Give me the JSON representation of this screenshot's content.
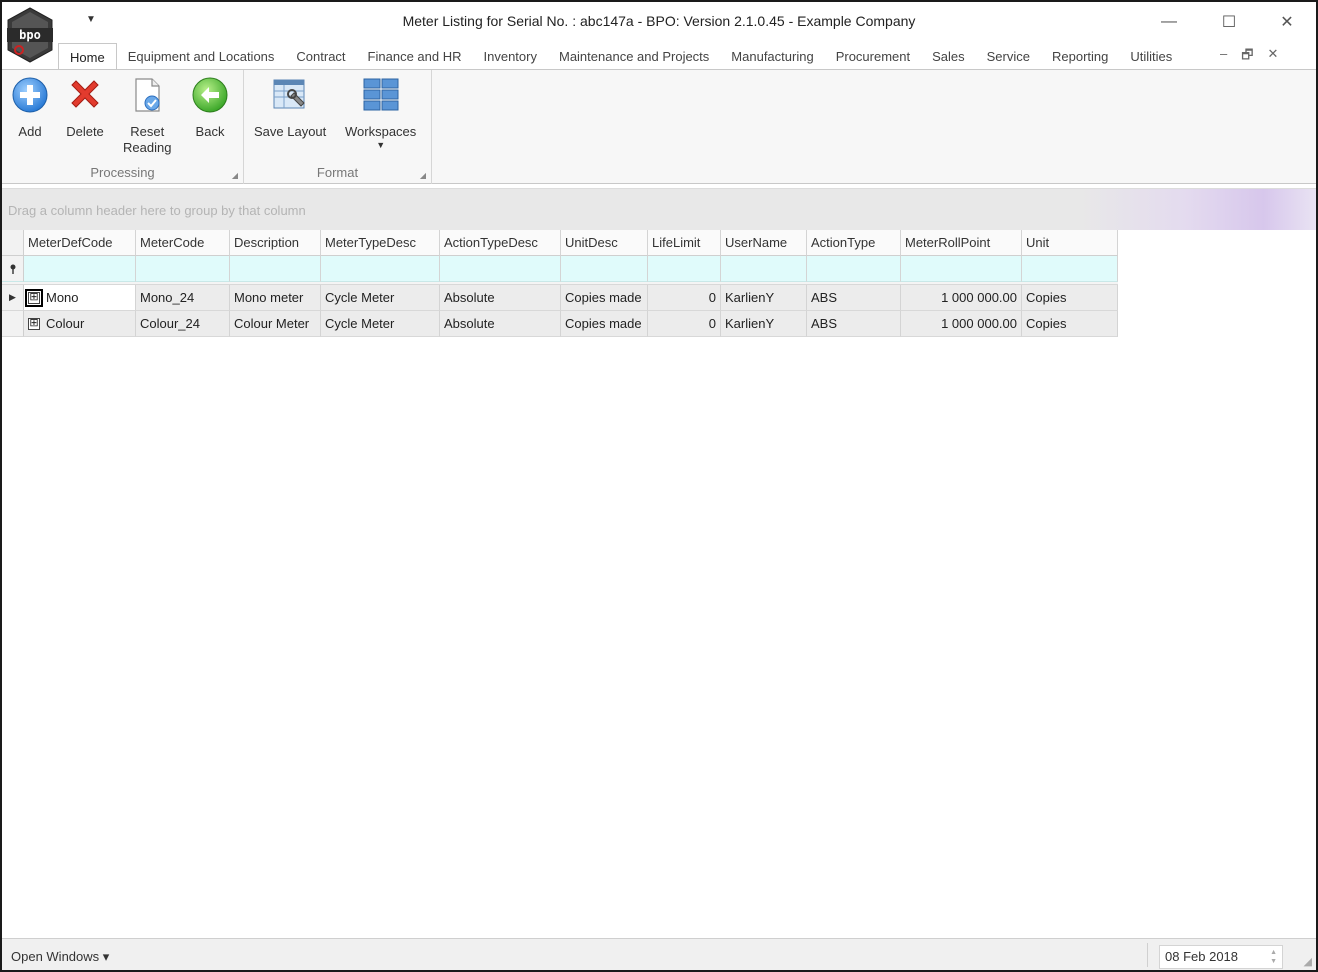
{
  "window": {
    "title": "Meter Listing for Serial No. : abc147a - BPO: Version 2.1.0.45 - Example Company",
    "logo_text": "bpo",
    "qat_icon": "dropdown-arrow-icon",
    "minimize_glyph": "—",
    "maximize_glyph": "☐",
    "close_glyph": "✕"
  },
  "menu": {
    "tabs": [
      "Home",
      "Equipment and Locations",
      "Contract",
      "Finance and HR",
      "Inventory",
      "Maintenance and Projects",
      "Manufacturing",
      "Procurement",
      "Sales",
      "Service",
      "Reporting",
      "Utilities"
    ],
    "active_tab": "Home",
    "mdi_minimize": "–",
    "mdi_restore": "🗗",
    "mdi_close": "✕"
  },
  "ribbon": {
    "groups": [
      {
        "label": "Processing",
        "buttons": [
          {
            "label": "Add",
            "icon": "add-plus-icon"
          },
          {
            "label": "Delete",
            "icon": "delete-x-icon"
          },
          {
            "label_line1": "Reset",
            "label_line2": "Reading",
            "icon": "reset-reading-document-icon"
          },
          {
            "label": "Back",
            "icon": "back-arrow-icon"
          }
        ]
      },
      {
        "label": "Format",
        "buttons": [
          {
            "label": "Save Layout",
            "icon": "save-layout-icon"
          },
          {
            "label": "Workspaces",
            "icon": "workspaces-grid-icon"
          }
        ]
      }
    ]
  },
  "grid": {
    "group_panel_text": "Drag a column header here to group by that column",
    "columns": [
      "MeterDefCode",
      "MeterCode",
      "Description",
      "MeterTypeDesc",
      "ActionTypeDesc",
      "UnitDesc",
      "LifeLimit",
      "UserName",
      "ActionType",
      "MeterRollPoint",
      "Unit"
    ],
    "rows": [
      [
        "Mono",
        "Mono_24",
        "Mono meter",
        "Cycle Meter",
        "Absolute",
        "Copies made",
        "0",
        "KarlienY",
        "ABS",
        "1 000 000.00",
        "Copies"
      ],
      [
        "Colour",
        "Colour_24",
        "Colour Meter",
        "Cycle Meter",
        "Absolute",
        "Copies made",
        "0",
        "KarlienY",
        "ABS",
        "1 000 000.00",
        "Copies"
      ]
    ],
    "filter_icon": "pin-filter-icon",
    "row_indicator": "▶",
    "expander": "⊞"
  },
  "statusbar": {
    "open_windows": "Open Windows ▾",
    "date": "08 Feb 2018"
  }
}
